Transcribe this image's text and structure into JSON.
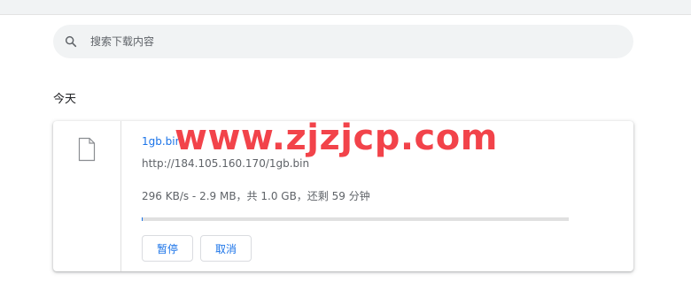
{
  "search": {
    "placeholder": "搜索下载内容",
    "icon": "search-icon"
  },
  "section": {
    "date_label": "今天"
  },
  "download": {
    "file_name": "1gb.bin",
    "url": "http://184.105.160.170/1gb.bin",
    "progress_text": "296 KB/s - 2.9 MB，共 1.0 GB，还剩 59 分钟",
    "progress_fraction": 0.0028,
    "file_icon": "file-icon",
    "pause_label": "暂停",
    "cancel_label": "取消"
  },
  "watermark": {
    "text": "www.zjzjcp.com"
  },
  "colors": {
    "accent": "#1a73e8",
    "watermark": "#f2434a",
    "secondary_text": "#5f6368",
    "search_bg": "#f1f3f4"
  }
}
